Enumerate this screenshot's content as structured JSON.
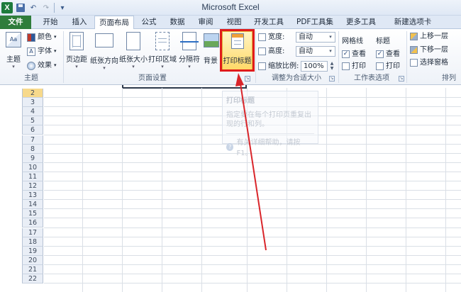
{
  "window": {
    "title": "Microsoft Excel"
  },
  "quick_access": {
    "separator_glyph": "│",
    "undo_glyph": "↶",
    "redo_glyph": "↷",
    "customize_glyph": "▾",
    "logo_letter": "X"
  },
  "tabs": [
    {
      "label": "文件"
    },
    {
      "label": "开始"
    },
    {
      "label": "插入"
    },
    {
      "label": "页面布局"
    },
    {
      "label": "公式"
    },
    {
      "label": "数据"
    },
    {
      "label": "审阅"
    },
    {
      "label": "视图"
    },
    {
      "label": "开发工具"
    },
    {
      "label": "PDF工具集"
    },
    {
      "label": "更多工具"
    },
    {
      "label": "新建选项卡"
    }
  ],
  "ribbon": {
    "theme_group": {
      "label": "主题",
      "theme_button": "主题",
      "colors": "颜色",
      "fonts": "字体",
      "effects": "效果"
    },
    "page_setup_group": {
      "label": "页面设置",
      "margins": "页边距",
      "orientation": "纸张方向",
      "size": "纸张大小",
      "print_area": "打印区域",
      "breaks": "分隔符",
      "background": "背景",
      "print_titles": "打印标题"
    },
    "scale_group": {
      "label": "调整为合适大小",
      "width_label": "宽度:",
      "width_value": "自动",
      "height_label": "高度:",
      "height_value": "自动",
      "scale_label": "缩放比例:",
      "scale_value": "100%"
    },
    "sheet_options_group": {
      "label": "工作表选项",
      "gridlines": "网格线",
      "headings": "标题",
      "view": "查看",
      "print": "打印",
      "gridlines_view_checked": true,
      "headings_view_checked": true,
      "check_glyph": "✓"
    },
    "arrange_group": {
      "label": "排列",
      "bring_forward": "上移一层",
      "send_backward": "下移一层",
      "selection_pane": "选择窗格"
    },
    "dropdown_glyph": "▾",
    "spin_up_glyph": "▲",
    "spin_down_glyph": "▼",
    "launcher_glyph": "↘"
  },
  "tooltip": {
    "title": "打印标题",
    "body": "指定要在每个打印页重复出现的行和列。",
    "help": "有关详细帮助，请按 F1。",
    "help_glyph": "?"
  },
  "sheet": {
    "selected_row": "2",
    "rows": [
      "2",
      "3",
      "4",
      "5",
      "6",
      "7",
      "8",
      "9",
      "10",
      "11",
      "12",
      "13",
      "14",
      "15",
      "16",
      "17",
      "18",
      "19",
      "20",
      "21",
      "22"
    ]
  },
  "colors": {
    "file_tab": "#2f7d3b",
    "highlight": "#e01b1b",
    "arrow": "#d9252a"
  }
}
